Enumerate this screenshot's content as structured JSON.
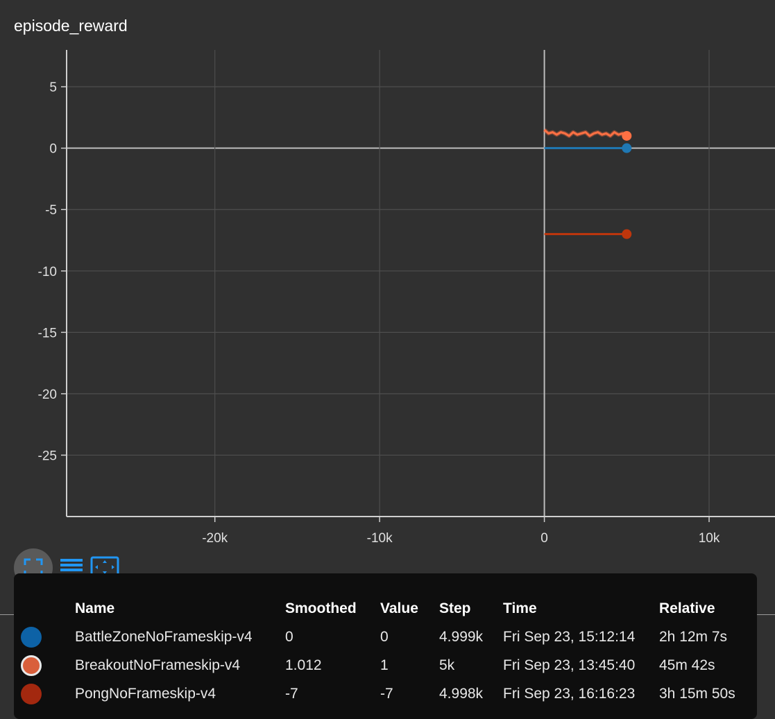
{
  "chart_data": {
    "type": "line",
    "title": "episode_reward",
    "xlim": [
      -29000,
      14000
    ],
    "ylim": [
      -30,
      8
    ],
    "x_ticks": [
      -20000,
      -10000,
      0,
      10000
    ],
    "x_tick_labels": [
      "-20k",
      "-10k",
      "0",
      "10k"
    ],
    "y_ticks": [
      5,
      0,
      -5,
      -10,
      -15,
      -20,
      -25
    ],
    "y_tick_labels": [
      "5",
      "0",
      "-5",
      "-10",
      "-15",
      "-20",
      "-25"
    ],
    "grid": true,
    "series": [
      {
        "name": "BattleZoneNoFrameskip-v4",
        "color": "#1f78b4",
        "x": [
          0,
          4999
        ],
        "y": [
          0,
          0
        ]
      },
      {
        "name": "BreakoutNoFrameskip-v4",
        "color": "#ff7043",
        "x": [
          0,
          250,
          500,
          750,
          1000,
          1250,
          1500,
          1750,
          2000,
          2250,
          2500,
          2750,
          3000,
          3250,
          3500,
          3750,
          4000,
          4250,
          4500,
          4750,
          5000
        ],
        "y": [
          1.5,
          1.2,
          1.3,
          1.1,
          1.3,
          1.2,
          1.0,
          1.3,
          1.1,
          1.2,
          1.3,
          1.0,
          1.2,
          1.3,
          1.1,
          1.2,
          1.0,
          1.3,
          1.1,
          1.2,
          1.0
        ]
      },
      {
        "name": "PongNoFrameskip-v4",
        "color": "#bf360c",
        "x": [
          0,
          4998
        ],
        "y": [
          -7,
          -7
        ]
      }
    ]
  },
  "toolbar": {
    "icons": [
      "fit-domain-icon",
      "toggle-data-table-icon",
      "toggle-y-axis-zoom-icon"
    ]
  },
  "table": {
    "headers": [
      "Name",
      "Smoothed",
      "Value",
      "Step",
      "Time",
      "Relative"
    ],
    "rows": [
      {
        "color": "#0d62a6",
        "ring": false,
        "name": "BattleZoneNoFrameskip-v4",
        "smoothed": "0",
        "value": "0",
        "step": "4.999k",
        "time": "Fri Sep 23, 15:12:14",
        "relative": "2h 12m 7s"
      },
      {
        "color": "#d95f3b",
        "ring": true,
        "name": "BreakoutNoFrameskip-v4",
        "smoothed": "1.012",
        "value": "1",
        "step": "5k",
        "time": "Fri Sep 23, 13:45:40",
        "relative": "45m 42s"
      },
      {
        "color": "#a3280f",
        "ring": false,
        "name": "PongNoFrameskip-v4",
        "smoothed": "-7",
        "value": "-7",
        "step": "4.998k",
        "time": "Fri Sep 23, 16:16:23",
        "relative": "3h 15m 50s"
      }
    ]
  }
}
